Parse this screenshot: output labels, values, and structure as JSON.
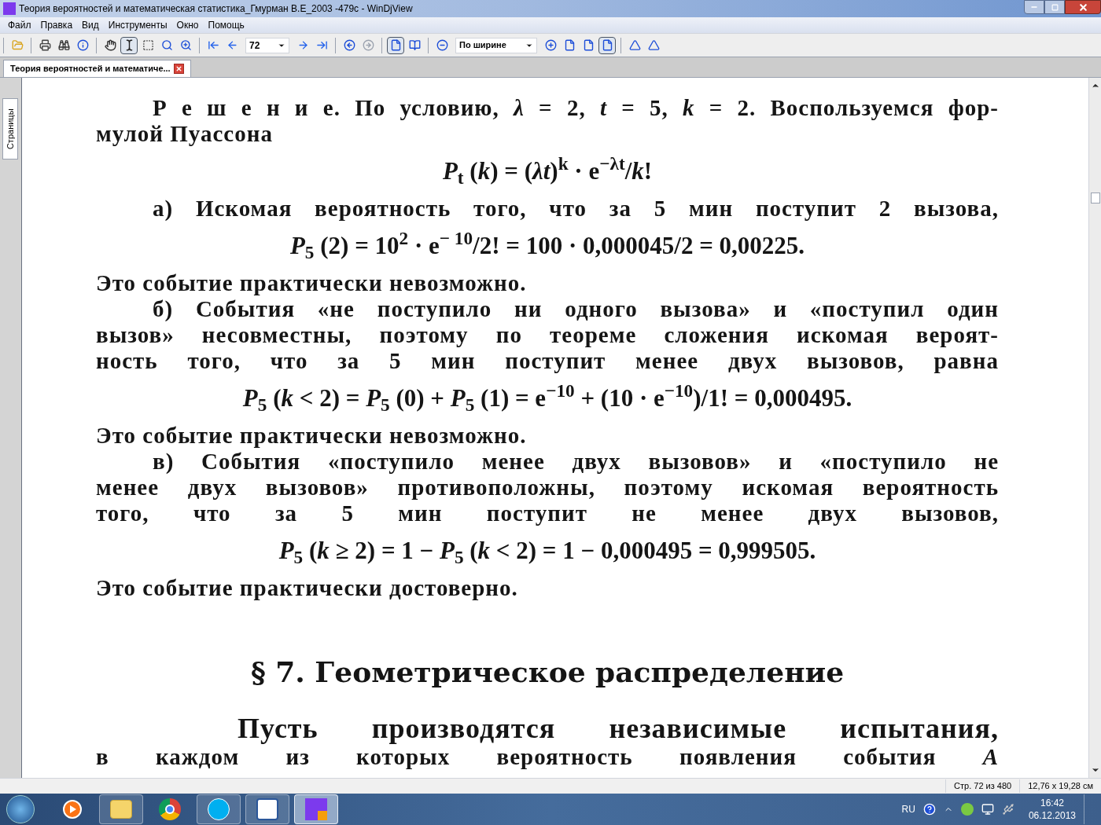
{
  "window": {
    "title": "Теория вероятностей и математическая статистика_Гмурман В.Е_2003 -479с - WinDjView"
  },
  "menu": [
    "Файл",
    "Правка",
    "Вид",
    "Инструменты",
    "Окно",
    "Помощь"
  ],
  "toolbar": {
    "page_field": "72",
    "zoom_field": "По ширине",
    "buttons": [
      {
        "kind": "open",
        "pressed": false
      },
      {
        "kind": "sep"
      },
      {
        "kind": "print",
        "pressed": false
      },
      {
        "kind": "find",
        "pressed": false
      },
      {
        "kind": "info",
        "pressed": false
      },
      {
        "kind": "sep"
      },
      {
        "kind": "hand",
        "pressed": false
      },
      {
        "kind": "text-select",
        "pressed": true
      },
      {
        "kind": "rect-select",
        "pressed": false
      },
      {
        "kind": "zoom-tool",
        "pressed": false
      },
      {
        "kind": "zoom-rect",
        "pressed": false
      },
      {
        "kind": "sep"
      },
      {
        "kind": "first",
        "pressed": false
      },
      {
        "kind": "prev",
        "pressed": false
      },
      {
        "kind": "page-field"
      },
      {
        "kind": "next",
        "pressed": false
      },
      {
        "kind": "last",
        "pressed": false
      },
      {
        "kind": "sep"
      },
      {
        "kind": "back",
        "pressed": false
      },
      {
        "kind": "forward",
        "pressed": false,
        "disabled": true
      },
      {
        "kind": "sep"
      },
      {
        "kind": "single",
        "pressed": true
      },
      {
        "kind": "facing",
        "pressed": false
      },
      {
        "kind": "sep"
      },
      {
        "kind": "zoom-out",
        "pressed": false
      },
      {
        "kind": "zoom-field"
      },
      {
        "kind": "zoom-in",
        "pressed": false
      },
      {
        "kind": "fit-height",
        "pressed": false
      },
      {
        "kind": "fit-page",
        "pressed": false
      },
      {
        "kind": "fit-width",
        "pressed": true
      },
      {
        "kind": "sep"
      },
      {
        "kind": "rotate-left",
        "pressed": false
      },
      {
        "kind": "rotate-right",
        "pressed": false
      }
    ]
  },
  "tabs": [
    {
      "label": "Теория вероятностей и математиче...",
      "selected": true
    }
  ],
  "side_panel": {
    "label": "Страницы"
  },
  "page": {
    "blocks": [
      {
        "kind": "first",
        "text": "**Р е ш е н и е.** По условию, *λ* = 2, *t* = 5, *k* = 2. Воспользуемся фор-"
      },
      {
        "kind": "end",
        "text": "мулой Пуассона"
      },
      {
        "kind": "formula",
        "text": "*P*$_{t}$ (*k*) = (*λt*)$^{k}$ · e$^{−λt}$/*k*!"
      },
      {
        "kind": "first",
        "text": "а) Искомая вероятность того, что за 5 мин поступит 2 вызова,"
      },
      {
        "kind": "formula",
        "text": "*P*$_{5}$ (2) = 10$^{2}$ · e$^{− 10}$/2! = 100 · 0,000045/2 = 0,00225."
      },
      {
        "kind": "end",
        "text": "Это событие практически невозможно."
      },
      {
        "kind": "first",
        "text": "б) События «не поступило ни одного вызова» и «поступил один"
      },
      {
        "kind": "line",
        "text": "вызов» несовместны, поэтому по теореме сложения искомая вероят-"
      },
      {
        "kind": "line",
        "text": "ность того, что за 5 мин поступит менее двух вызовов, равна"
      },
      {
        "kind": "formula",
        "text": "*P*$_{5}$ (*k* < 2) = *P*$_{5}$ (0) + *P*$_{5}$ (1) = e$^{−10}$ + (10 · e$^{−10}$)/1! = 0,000495."
      },
      {
        "kind": "end",
        "text": "Это событие практически невозможно."
      },
      {
        "kind": "first",
        "text": "в) События «поступило менее двух вызовов» и «поступило не"
      },
      {
        "kind": "line",
        "text": "менее двух вызовов» противоположны, поэтому искомая вероятность"
      },
      {
        "kind": "line",
        "text": "того, что за 5 мин поступит не менее двух вызовов,"
      },
      {
        "kind": "formula",
        "text": "*P*$_{5}$ (*k* ≥ 2) = 1 − *P*$_{5}$ (*k* < 2) = 1 − 0,000495 = 0,999505."
      },
      {
        "kind": "end",
        "text": "Это событие практически достоверно."
      },
      {
        "kind": "heading",
        "text": "§ 7. Геометрическое распределение"
      },
      {
        "kind": "wide-first",
        "text": "Пусть производятся независимые испытания,"
      },
      {
        "kind": "line",
        "text": "в каждом из которых вероятность появления события *A*"
      }
    ]
  },
  "status_bar": [
    "Стр. 72 из 480",
    "12,76 x 19,28 см"
  ],
  "taskbar": {
    "apps": [
      {
        "kind": "media",
        "active": false,
        "running": false
      },
      {
        "kind": "explorer",
        "active": false,
        "running": true
      },
      {
        "kind": "chrome",
        "active": false,
        "running": false
      },
      {
        "kind": "skype",
        "active": false,
        "running": true
      },
      {
        "kind": "word",
        "active": false,
        "running": true
      },
      {
        "kind": "windjview",
        "active": true,
        "running": true
      }
    ],
    "language": "RU",
    "time": "16:42",
    "date": "06.12.2013"
  }
}
